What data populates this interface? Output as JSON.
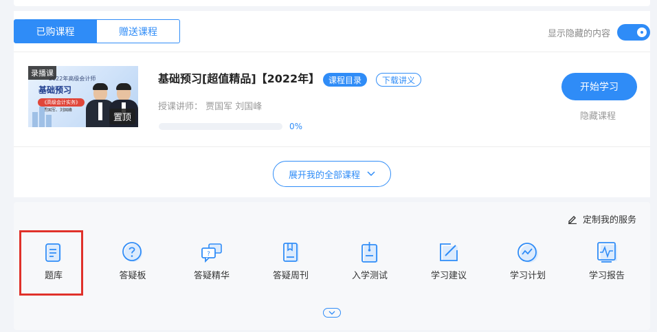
{
  "tabs": [
    {
      "label": "已购课程",
      "active": true
    },
    {
      "label": "赠送课程",
      "active": false
    }
  ],
  "hidden_toggle": {
    "label": "显示隐藏的内容",
    "on": true
  },
  "course": {
    "thumb": {
      "badge": "录播课",
      "small_text": "2022年高级会计师",
      "big_text": "基础预习",
      "pill_text": "《高级会计实务》",
      "teachers_text": "贾国军、刘国峰",
      "pin_label": "置顶"
    },
    "title": "基础预习[超值精品]【2022年】",
    "catalog_label": "课程目录",
    "download_label": "下载讲义",
    "teacher_line": "授课讲师： 贾国军 刘国峰",
    "progress_percent": 0,
    "progress_label": "0%",
    "start_label": "开始学习",
    "hide_label": "隐藏课程"
  },
  "expand_label": "展开我的全部课程",
  "services": {
    "custom_label": "定制我的服务",
    "items": [
      {
        "label": "题库",
        "icon": "question-bank-icon"
      },
      {
        "label": "答疑板",
        "icon": "question-circle-icon"
      },
      {
        "label": "答疑精华",
        "icon": "chat-bubbles-icon"
      },
      {
        "label": "答疑周刊",
        "icon": "book-icon"
      },
      {
        "label": "入学测试",
        "icon": "clipboard-icon"
      },
      {
        "label": "学习建议",
        "icon": "edit-note-icon"
      },
      {
        "label": "学习计划",
        "icon": "trend-circle-icon"
      },
      {
        "label": "学习报告",
        "icon": "report-chart-icon"
      }
    ]
  },
  "colors": {
    "accent": "#2f8cf7",
    "highlight": "#e0312a"
  }
}
